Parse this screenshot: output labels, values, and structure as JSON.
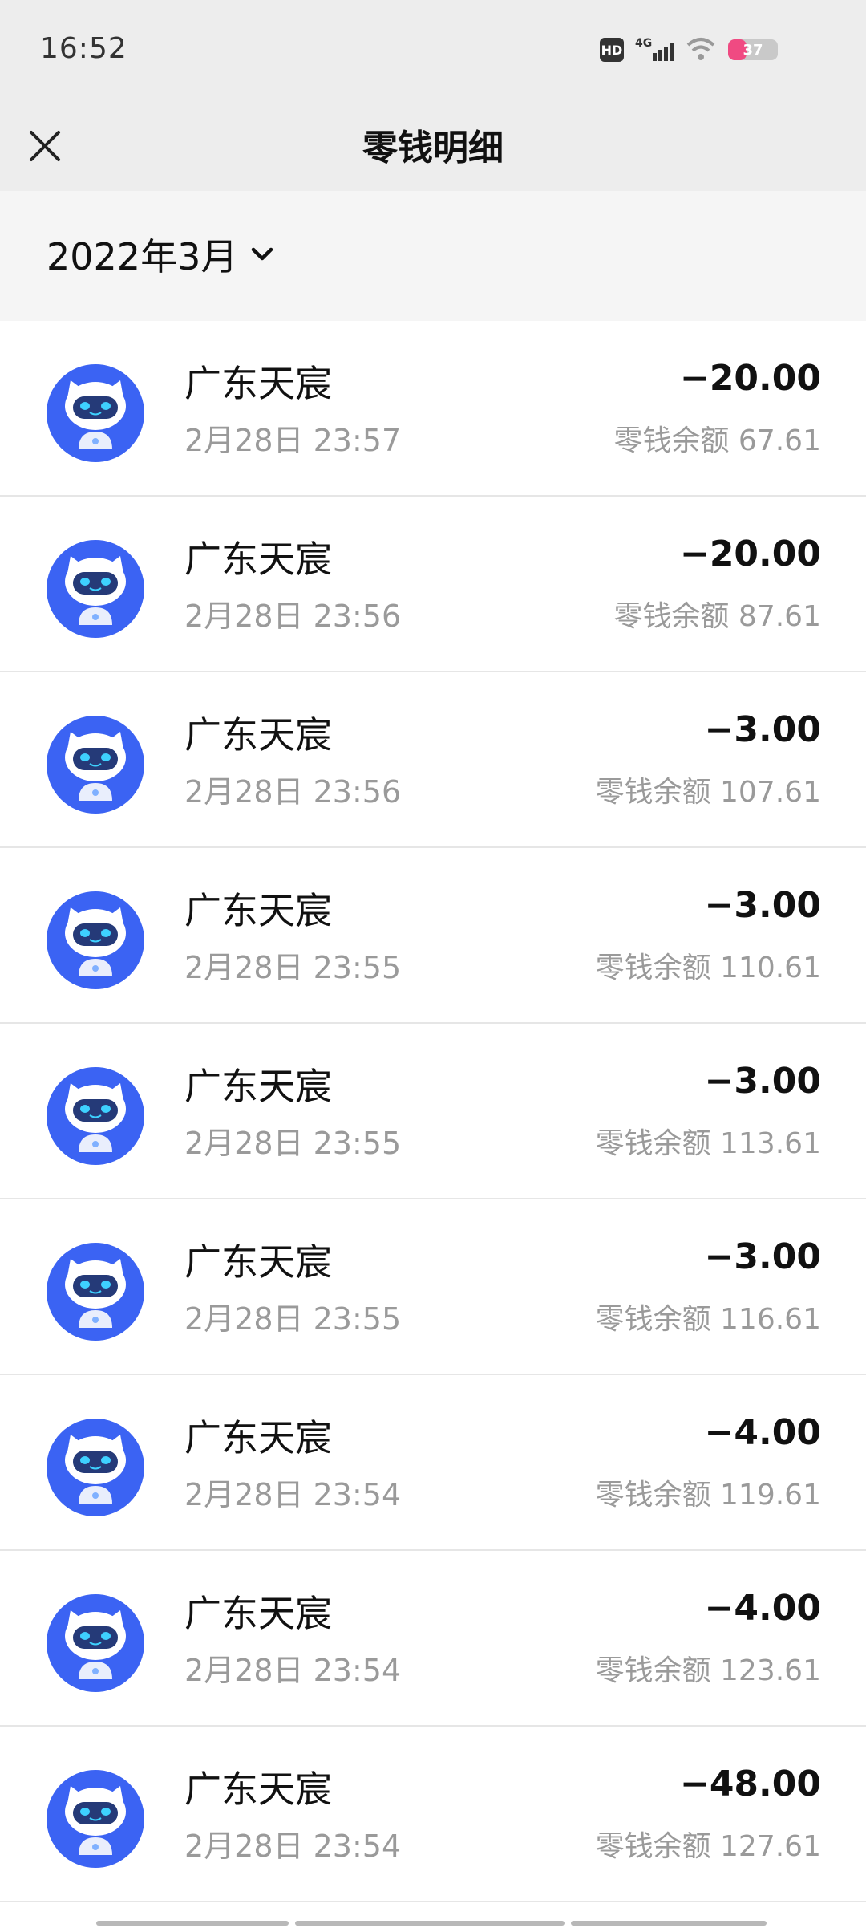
{
  "status_bar": {
    "time": "16:52",
    "hd_label": "HD",
    "network_label": "4G",
    "battery_level": "37",
    "battery_fraction": 0.37,
    "icons": [
      "hd-icon",
      "signal-4g-icon",
      "wifi-icon",
      "battery-icon"
    ]
  },
  "header": {
    "title": "零钱明细",
    "close_icon": "close-icon"
  },
  "filter": {
    "month_label": "2022年3月",
    "dropdown_icon": "chevron-down-icon"
  },
  "colors": {
    "accent_avatar": "#3b63f3",
    "text_primary": "#111111",
    "text_secondary": "#9a9a9a",
    "header_bg": "#ededed"
  },
  "transactions": [
    {
      "merchant": "广东天宸",
      "datetime": "2月28日 23:57",
      "amount": "−20.00",
      "balance": "零钱余额 67.61"
    },
    {
      "merchant": "广东天宸",
      "datetime": "2月28日 23:56",
      "amount": "−20.00",
      "balance": "零钱余额 87.61"
    },
    {
      "merchant": "广东天宸",
      "datetime": "2月28日 23:56",
      "amount": "−3.00",
      "balance": "零钱余额 107.61"
    },
    {
      "merchant": "广东天宸",
      "datetime": "2月28日 23:55",
      "amount": "−3.00",
      "balance": "零钱余额 110.61"
    },
    {
      "merchant": "广东天宸",
      "datetime": "2月28日 23:55",
      "amount": "−3.00",
      "balance": "零钱余额 113.61"
    },
    {
      "merchant": "广东天宸",
      "datetime": "2月28日 23:55",
      "amount": "−3.00",
      "balance": "零钱余额 116.61"
    },
    {
      "merchant": "广东天宸",
      "datetime": "2月28日 23:54",
      "amount": "−4.00",
      "balance": "零钱余额 119.61"
    },
    {
      "merchant": "广东天宸",
      "datetime": "2月28日 23:54",
      "amount": "−4.00",
      "balance": "零钱余额 123.61"
    },
    {
      "merchant": "广东天宸",
      "datetime": "2月28日 23:54",
      "amount": "−48.00",
      "balance": "零钱余额 127.61"
    }
  ]
}
